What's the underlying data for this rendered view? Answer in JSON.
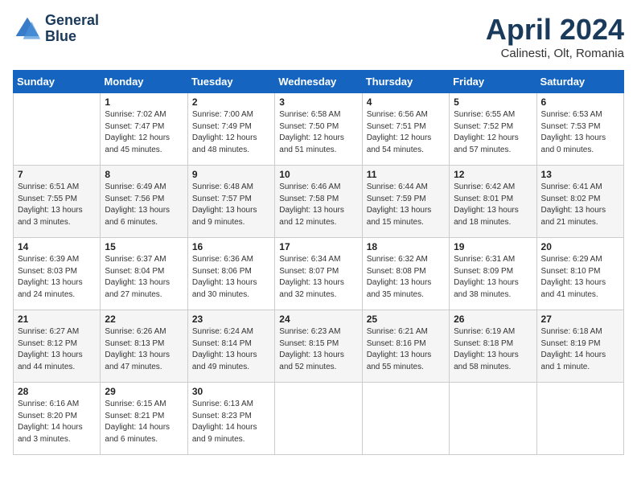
{
  "header": {
    "logo_line1": "General",
    "logo_line2": "Blue",
    "month": "April 2024",
    "location": "Calinesti, Olt, Romania"
  },
  "columns": [
    "Sunday",
    "Monday",
    "Tuesday",
    "Wednesday",
    "Thursday",
    "Friday",
    "Saturday"
  ],
  "weeks": [
    [
      {
        "day": "",
        "lines": []
      },
      {
        "day": "1",
        "lines": [
          "Sunrise: 7:02 AM",
          "Sunset: 7:47 PM",
          "Daylight: 12 hours",
          "and 45 minutes."
        ]
      },
      {
        "day": "2",
        "lines": [
          "Sunrise: 7:00 AM",
          "Sunset: 7:49 PM",
          "Daylight: 12 hours",
          "and 48 minutes."
        ]
      },
      {
        "day": "3",
        "lines": [
          "Sunrise: 6:58 AM",
          "Sunset: 7:50 PM",
          "Daylight: 12 hours",
          "and 51 minutes."
        ]
      },
      {
        "day": "4",
        "lines": [
          "Sunrise: 6:56 AM",
          "Sunset: 7:51 PM",
          "Daylight: 12 hours",
          "and 54 minutes."
        ]
      },
      {
        "day": "5",
        "lines": [
          "Sunrise: 6:55 AM",
          "Sunset: 7:52 PM",
          "Daylight: 12 hours",
          "and 57 minutes."
        ]
      },
      {
        "day": "6",
        "lines": [
          "Sunrise: 6:53 AM",
          "Sunset: 7:53 PM",
          "Daylight: 13 hours",
          "and 0 minutes."
        ]
      }
    ],
    [
      {
        "day": "7",
        "lines": [
          "Sunrise: 6:51 AM",
          "Sunset: 7:55 PM",
          "Daylight: 13 hours",
          "and 3 minutes."
        ]
      },
      {
        "day": "8",
        "lines": [
          "Sunrise: 6:49 AM",
          "Sunset: 7:56 PM",
          "Daylight: 13 hours",
          "and 6 minutes."
        ]
      },
      {
        "day": "9",
        "lines": [
          "Sunrise: 6:48 AM",
          "Sunset: 7:57 PM",
          "Daylight: 13 hours",
          "and 9 minutes."
        ]
      },
      {
        "day": "10",
        "lines": [
          "Sunrise: 6:46 AM",
          "Sunset: 7:58 PM",
          "Daylight: 13 hours",
          "and 12 minutes."
        ]
      },
      {
        "day": "11",
        "lines": [
          "Sunrise: 6:44 AM",
          "Sunset: 7:59 PM",
          "Daylight: 13 hours",
          "and 15 minutes."
        ]
      },
      {
        "day": "12",
        "lines": [
          "Sunrise: 6:42 AM",
          "Sunset: 8:01 PM",
          "Daylight: 13 hours",
          "and 18 minutes."
        ]
      },
      {
        "day": "13",
        "lines": [
          "Sunrise: 6:41 AM",
          "Sunset: 8:02 PM",
          "Daylight: 13 hours",
          "and 21 minutes."
        ]
      }
    ],
    [
      {
        "day": "14",
        "lines": [
          "Sunrise: 6:39 AM",
          "Sunset: 8:03 PM",
          "Daylight: 13 hours",
          "and 24 minutes."
        ]
      },
      {
        "day": "15",
        "lines": [
          "Sunrise: 6:37 AM",
          "Sunset: 8:04 PM",
          "Daylight: 13 hours",
          "and 27 minutes."
        ]
      },
      {
        "day": "16",
        "lines": [
          "Sunrise: 6:36 AM",
          "Sunset: 8:06 PM",
          "Daylight: 13 hours",
          "and 30 minutes."
        ]
      },
      {
        "day": "17",
        "lines": [
          "Sunrise: 6:34 AM",
          "Sunset: 8:07 PM",
          "Daylight: 13 hours",
          "and 32 minutes."
        ]
      },
      {
        "day": "18",
        "lines": [
          "Sunrise: 6:32 AM",
          "Sunset: 8:08 PM",
          "Daylight: 13 hours",
          "and 35 minutes."
        ]
      },
      {
        "day": "19",
        "lines": [
          "Sunrise: 6:31 AM",
          "Sunset: 8:09 PM",
          "Daylight: 13 hours",
          "and 38 minutes."
        ]
      },
      {
        "day": "20",
        "lines": [
          "Sunrise: 6:29 AM",
          "Sunset: 8:10 PM",
          "Daylight: 13 hours",
          "and 41 minutes."
        ]
      }
    ],
    [
      {
        "day": "21",
        "lines": [
          "Sunrise: 6:27 AM",
          "Sunset: 8:12 PM",
          "Daylight: 13 hours",
          "and 44 minutes."
        ]
      },
      {
        "day": "22",
        "lines": [
          "Sunrise: 6:26 AM",
          "Sunset: 8:13 PM",
          "Daylight: 13 hours",
          "and 47 minutes."
        ]
      },
      {
        "day": "23",
        "lines": [
          "Sunrise: 6:24 AM",
          "Sunset: 8:14 PM",
          "Daylight: 13 hours",
          "and 49 minutes."
        ]
      },
      {
        "day": "24",
        "lines": [
          "Sunrise: 6:23 AM",
          "Sunset: 8:15 PM",
          "Daylight: 13 hours",
          "and 52 minutes."
        ]
      },
      {
        "day": "25",
        "lines": [
          "Sunrise: 6:21 AM",
          "Sunset: 8:16 PM",
          "Daylight: 13 hours",
          "and 55 minutes."
        ]
      },
      {
        "day": "26",
        "lines": [
          "Sunrise: 6:19 AM",
          "Sunset: 8:18 PM",
          "Daylight: 13 hours",
          "and 58 minutes."
        ]
      },
      {
        "day": "27",
        "lines": [
          "Sunrise: 6:18 AM",
          "Sunset: 8:19 PM",
          "Daylight: 14 hours",
          "and 1 minute."
        ]
      }
    ],
    [
      {
        "day": "28",
        "lines": [
          "Sunrise: 6:16 AM",
          "Sunset: 8:20 PM",
          "Daylight: 14 hours",
          "and 3 minutes."
        ]
      },
      {
        "day": "29",
        "lines": [
          "Sunrise: 6:15 AM",
          "Sunset: 8:21 PM",
          "Daylight: 14 hours",
          "and 6 minutes."
        ]
      },
      {
        "day": "30",
        "lines": [
          "Sunrise: 6:13 AM",
          "Sunset: 8:23 PM",
          "Daylight: 14 hours",
          "and 9 minutes."
        ]
      },
      {
        "day": "",
        "lines": []
      },
      {
        "day": "",
        "lines": []
      },
      {
        "day": "",
        "lines": []
      },
      {
        "day": "",
        "lines": []
      }
    ]
  ]
}
